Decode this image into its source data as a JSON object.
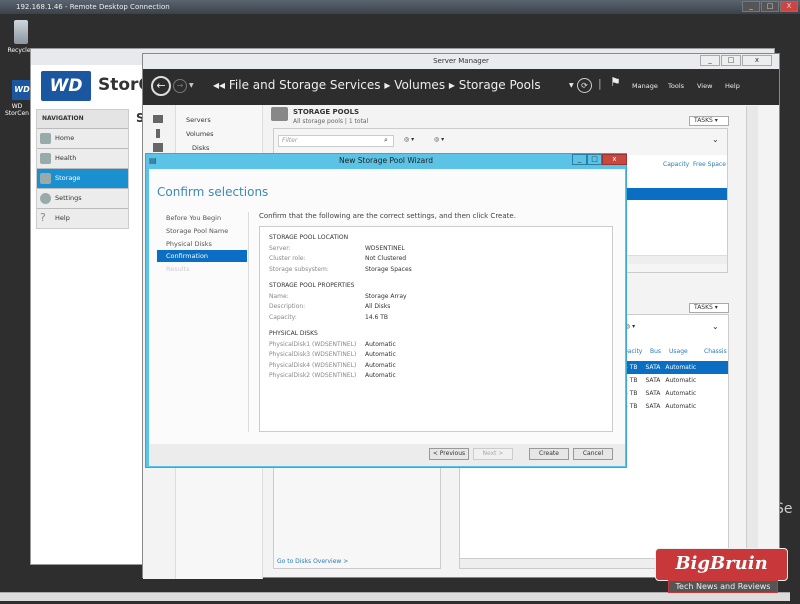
{
  "rdc": {
    "title": "192.168.1.46 - Remote Desktop Connection",
    "controls": [
      "_",
      "□",
      "X"
    ]
  },
  "desktop": {
    "icons": [
      {
        "label": "Recycle",
        "icon": "recycle-bin-icon"
      },
      {
        "label": "WD StorCen",
        "icon": "wd-icon"
      }
    ]
  },
  "storcenter": {
    "logo": "WD",
    "title": "StorCe",
    "section_letter": "S",
    "side_text": "Se",
    "nav_header": "NAVIGATION",
    "nav": [
      {
        "label": "Home"
      },
      {
        "label": "Health"
      },
      {
        "label": "Storage",
        "selected": true
      },
      {
        "label": "Settings"
      },
      {
        "label": "Help"
      }
    ]
  },
  "server_manager": {
    "title": "Server Manager",
    "breadcrumb": [
      "File and Storage Services",
      "Volumes",
      "Storage Pools"
    ],
    "menu": [
      "Manage",
      "Tools",
      "View",
      "Help"
    ],
    "nav": [
      "Servers",
      "Volumes",
      "Disks"
    ],
    "pools": {
      "title": "STORAGE POOLS",
      "subtitle": "All storage pools | 1 total",
      "tasks": "TASKS",
      "filter_placeholder": "Filter",
      "columns": [
        "Capacity",
        "Free Space"
      ]
    },
    "disks": {
      "tasks": "TASKS",
      "columns": [
        "pacity",
        "Bus",
        "Usage",
        "Chassis"
      ],
      "rows": [
        [
          "4 TB",
          "SATA",
          "Automatic"
        ],
        [
          "4 TB",
          "SATA",
          "Automatic"
        ],
        [
          "4 TB",
          "SATA",
          "Automatic"
        ],
        [
          "4 TB",
          "SATA",
          "Automatic"
        ]
      ],
      "link": "Go to Disks Overview >"
    }
  },
  "wizard": {
    "title": "New Storage Pool Wizard",
    "heading": "Confirm selections",
    "steps": [
      {
        "label": "Before You Begin"
      },
      {
        "label": "Storage Pool Name"
      },
      {
        "label": "Physical Disks"
      },
      {
        "label": "Confirmation",
        "selected": true
      },
      {
        "label": "Results",
        "disabled": true
      }
    ],
    "instruction": "Confirm that the following are the correct settings, and then click Create.",
    "sections": [
      {
        "title": "STORAGE POOL LOCATION",
        "items": [
          [
            "Server:",
            "WDSENTINEL"
          ],
          [
            "Cluster role:",
            "Not Clustered"
          ],
          [
            "Storage subsystem:",
            "Storage Spaces"
          ]
        ]
      },
      {
        "title": "STORAGE POOL PROPERTIES",
        "items": [
          [
            "Name:",
            "Storage Array"
          ],
          [
            "Description:",
            "All Disks"
          ],
          [
            "Capacity:",
            "14.6 TB"
          ]
        ]
      },
      {
        "title": "PHYSICAL DISKS",
        "items": [
          [
            "PhysicalDisk1 (WDSENTINEL)",
            "Automatic"
          ],
          [
            "PhysicalDisk3 (WDSENTINEL)",
            "Automatic"
          ],
          [
            "PhysicalDisk4 (WDSENTINEL)",
            "Automatic"
          ],
          [
            "PhysicalDisk2 (WDSENTINEL)",
            "Automatic"
          ]
        ]
      }
    ],
    "buttons": {
      "previous": "< Previous",
      "next": "Next >",
      "create": "Create",
      "cancel": "Cancel"
    }
  },
  "watermark": {
    "brand": "BigBruin",
    "tagline": "Tech News and Reviews"
  },
  "colors": {
    "accent": "#0a6fc2",
    "wizard_frame": "#5bc4e6",
    "storcenter_selected": "#1b90d1",
    "watermark": "#c8383a"
  }
}
